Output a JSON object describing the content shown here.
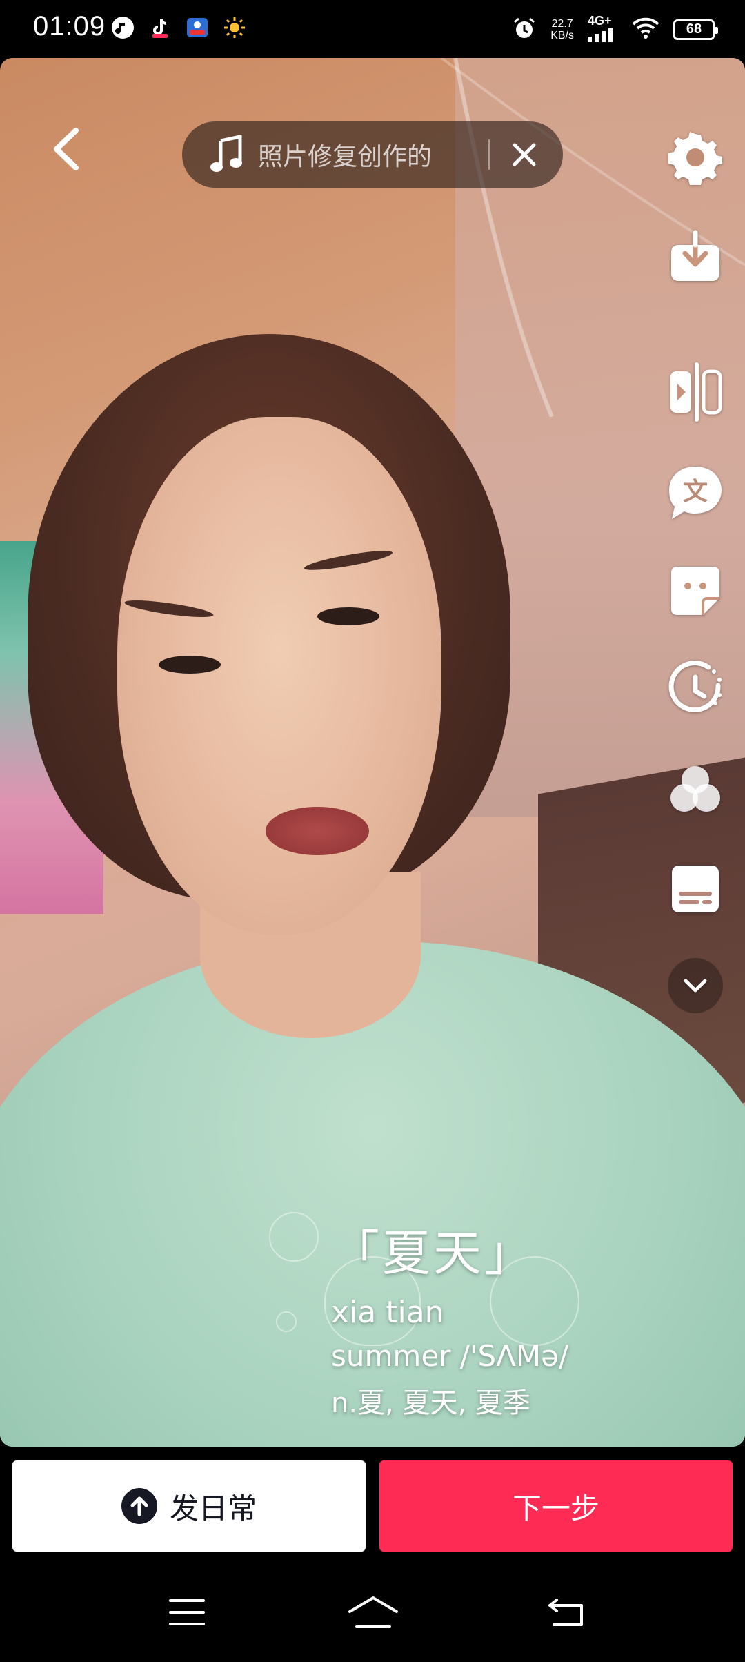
{
  "status_bar": {
    "time": "01:09",
    "net_speed_value": "22.7",
    "net_speed_unit": "KB/s",
    "network_type": "4G+",
    "battery": "68",
    "app_icons": [
      "music-app-icon",
      "tiktok-icon",
      "camera-app-icon",
      "weather-sun-icon"
    ]
  },
  "top_bar": {
    "music_title": "照片修复创作的"
  },
  "toolbar": {
    "items": [
      "settings-icon",
      "download-icon",
      "flip-icon",
      "text-icon",
      "sticker-icon",
      "timer-icon",
      "filter-icon",
      "subtitle-icon",
      "expand-more-icon"
    ]
  },
  "sticker": {
    "title": "「夏天」",
    "pinyin": "xia tian",
    "english": "summer /'SΛMə/",
    "meaning": "n.夏, 夏天, 夏季"
  },
  "actions": {
    "daily_label": "发日常",
    "next_label": "下一步"
  },
  "colors": {
    "primary": "#fe2c55",
    "dark": "#161823"
  }
}
